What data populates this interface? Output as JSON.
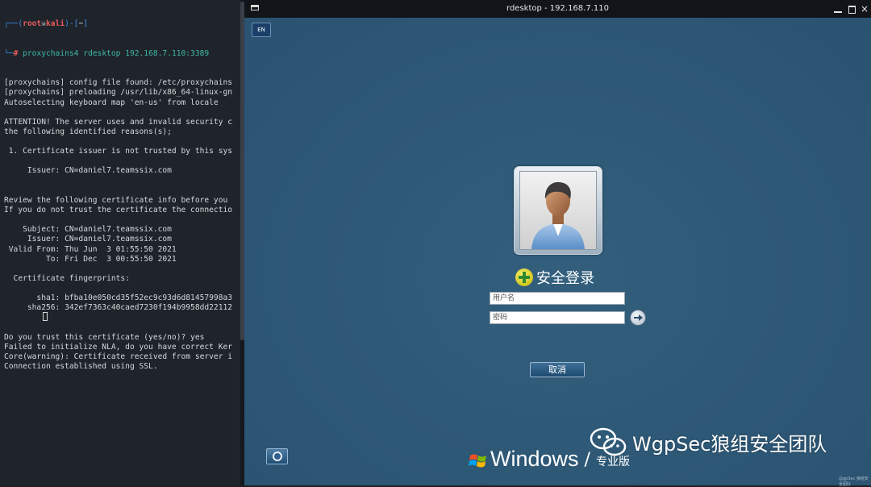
{
  "terminal": {
    "prompt_user": "root",
    "prompt_host": "kali",
    "prompt_dir": "~",
    "command": "proxychains4 rdesktop 192.168.7.110:3389",
    "lines": [
      "[proxychains] config file found: /etc/proxychains",
      "[proxychains] preloading /usr/lib/x86_64-linux-gn",
      "Autoselecting keyboard map 'en-us' from locale",
      "",
      "ATTENTION! The server uses and invalid security c",
      "the following identified reasons(s);",
      "",
      " 1. Certificate issuer is not trusted by this sys",
      "",
      "     Issuer: CN=daniel7.teamssix.com",
      "",
      "",
      "Review the following certificate info before you",
      "If you do not trust the certificate the connectio",
      "",
      "    Subject: CN=daniel7.teamssix.com",
      "     Issuer: CN=daniel7.teamssix.com",
      " Valid From: Thu Jun  3 01:55:50 2021",
      "         To: Fri Dec  3 00:55:50 2021",
      "",
      "  Certificate fingerprints:",
      "",
      "       sha1: bfba10e050cd35f52ec9c93d6d81457998a3",
      "     sha256: 342ef7363c40caed7230f194b9958dd22112",
      "",
      "",
      "Do you trust this certificate (yes/no)? yes",
      "Failed to initialize NLA, do you have correct Ker",
      "Core(warning): Certificate received from server i",
      "Connection established using SSL."
    ]
  },
  "rdp": {
    "window_title": "rdesktop - 192.168.7.110",
    "close_glyph": "×",
    "language": "EN",
    "login_title": "安全登录",
    "username_placeholder": "用户名",
    "password_placeholder": "密码",
    "cancel_label": "取消",
    "os_wordmark": "Windows",
    "edition_slash": "/",
    "edition": "专业版"
  },
  "watermark": {
    "text": "WgpSec狼组安全团队",
    "credit": "@gpSec 狼组安全团队"
  },
  "colors": {
    "terminal_bg": "#1f232a",
    "login_bg": "#2d5875",
    "titlebar_bg": "#111418",
    "prompt_root": "#e85d5d",
    "prompt_cmd": "#3eb8a8"
  }
}
